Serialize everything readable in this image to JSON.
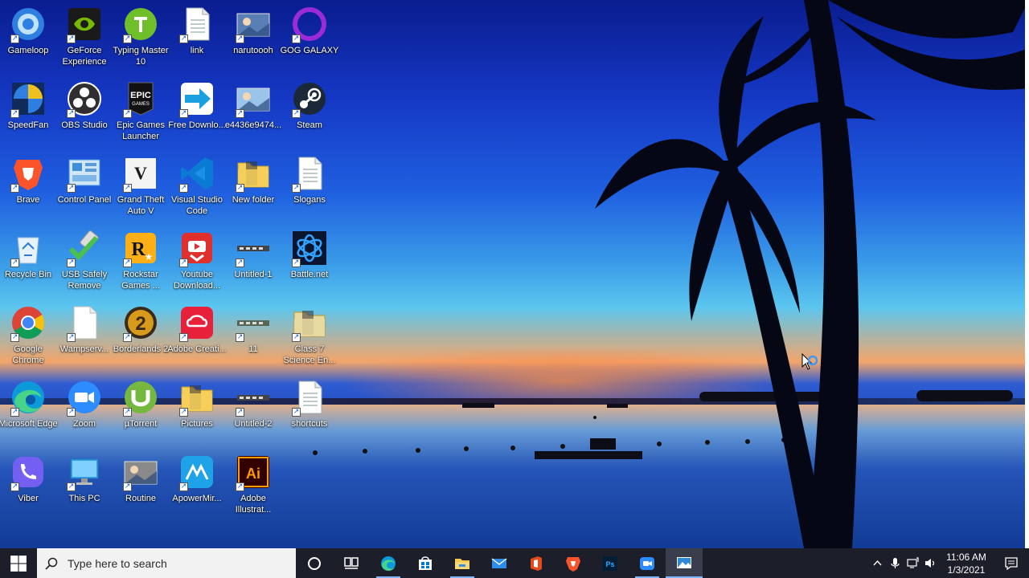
{
  "desktop": {
    "icons": [
      {
        "label": "Gameloop",
        "icon": "gameloop-icon",
        "color": "#2f7fe0"
      },
      {
        "label": "GeForce Experience",
        "icon": "geforce-icon",
        "color": "#76b900"
      },
      {
        "label": "Typing Master 10",
        "icon": "typing-master-icon",
        "color": "#6fbf2a"
      },
      {
        "label": "link",
        "icon": "document-icon",
        "color": "#ffffff"
      },
      {
        "label": "narutoooh",
        "icon": "image-file-icon",
        "color": "#5a7fb5"
      },
      {
        "label": "GOG GALAXY",
        "icon": "gog-galaxy-icon",
        "color": "#9b2bd8"
      },
      {
        "label": "SpeedFan",
        "icon": "speedfan-icon",
        "color": "#f0c020"
      },
      {
        "label": "OBS Studio",
        "icon": "obs-icon",
        "color": "#302e31"
      },
      {
        "label": "Epic Games Launcher",
        "icon": "epic-games-icon",
        "color": "#111111"
      },
      {
        "label": "Free Downlo...",
        "icon": "free-download-icon",
        "color": "#18a0e0"
      },
      {
        "label": "e4436e9474...",
        "icon": "image-file-icon",
        "color": "#9ac4e8"
      },
      {
        "label": "Steam",
        "icon": "steam-icon",
        "color": "#1b2838"
      },
      {
        "label": "Brave",
        "icon": "brave-icon",
        "color": "#fb542b"
      },
      {
        "label": "Control Panel",
        "icon": "control-panel-icon",
        "color": "#3f8fd8"
      },
      {
        "label": "Grand Theft Auto V",
        "icon": "gta-icon",
        "color": "#222222"
      },
      {
        "label": "Visual Studio Code",
        "icon": "vscode-icon",
        "color": "#0a7bd4"
      },
      {
        "label": "New folder",
        "icon": "folder-icon",
        "color": "#f5cf5a"
      },
      {
        "label": "Slogans",
        "icon": "document-icon",
        "color": "#ffffff"
      },
      {
        "label": "Recycle Bin",
        "icon": "recycle-bin-icon",
        "color": "#cfe3f5"
      },
      {
        "label": "USB Safely Remove",
        "icon": "usb-icon",
        "color": "#4cbf4c"
      },
      {
        "label": "Rockstar Games ...",
        "icon": "rockstar-icon",
        "color": "#fcaf17"
      },
      {
        "label": "Youtube Download...",
        "icon": "youtube-downloader-icon",
        "color": "#e0302e"
      },
      {
        "label": "Untitled-1",
        "icon": "image-strip-icon",
        "color": "#444444"
      },
      {
        "label": "Battle.net",
        "icon": "battlenet-icon",
        "color": "#1a6fb8"
      },
      {
        "label": "Google Chrome",
        "icon": "chrome-icon",
        "color": "#db4437"
      },
      {
        "label": "Wampserv...",
        "icon": "blank-file-icon",
        "color": "#ffffff"
      },
      {
        "label": "Borderlands 2",
        "icon": "borderlands-icon",
        "color": "#d89a1a"
      },
      {
        "label": "Adobe Creati...",
        "icon": "adobe-cc-icon",
        "color": "#e8213a"
      },
      {
        "label": "11",
        "icon": "image-strip-icon",
        "color": "#556655"
      },
      {
        "label": "Class 7 Science En...",
        "icon": "folder-icon",
        "color": "#e8d9a0"
      },
      {
        "label": "Microsoft Edge",
        "icon": "edge-icon",
        "color": "#0c9bd8"
      },
      {
        "label": "Zoom",
        "icon": "zoom-icon",
        "color": "#2d8cff"
      },
      {
        "label": "µTorrent",
        "icon": "utorrent-icon",
        "color": "#76b83f"
      },
      {
        "label": "Pictures",
        "icon": "folder-icon",
        "color": "#f5cf5a"
      },
      {
        "label": "Untitled-2",
        "icon": "image-strip-icon",
        "color": "#444444"
      },
      {
        "label": "shortcuts",
        "icon": "document-icon",
        "color": "#ffffff"
      },
      {
        "label": "Viber",
        "icon": "viber-icon",
        "color": "#7360f2"
      },
      {
        "label": "This PC",
        "icon": "this-pc-icon",
        "color": "#38a4e8"
      },
      {
        "label": "Routine",
        "icon": "image-file-icon",
        "color": "#8a8a8a"
      },
      {
        "label": "ApowerMir...",
        "icon": "apowermirror-icon",
        "color": "#1fa3e8"
      },
      {
        "label": "Adobe Illustrat...",
        "icon": "illustrator-icon",
        "color": "#ff9a00"
      }
    ]
  },
  "taskbar": {
    "search_placeholder": "Type here to search",
    "pinned": [
      {
        "name": "cortana-icon"
      },
      {
        "name": "task-view-icon"
      },
      {
        "name": "edge-icon"
      },
      {
        "name": "store-icon"
      },
      {
        "name": "file-explorer-icon"
      },
      {
        "name": "mail-icon"
      },
      {
        "name": "office-icon"
      },
      {
        "name": "brave-icon"
      },
      {
        "name": "photoshop-icon"
      },
      {
        "name": "zoom-icon"
      },
      {
        "name": "photos-icon"
      }
    ],
    "clock": {
      "time": "11:06 AM",
      "date": "1/3/2021"
    }
  },
  "colors": {
    "taskbar_bg": "#1c1e2a",
    "search_bg": "#f2f2f2",
    "accent": "#7fb4ff"
  }
}
